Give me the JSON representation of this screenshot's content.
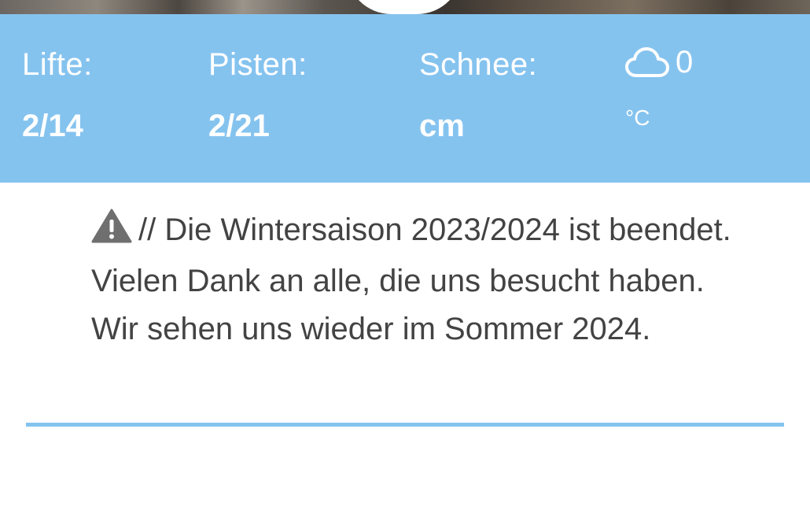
{
  "stats": {
    "lifts_label": "Lifte:",
    "lifts_value": "2/14",
    "slopes_label": "Pisten:",
    "slopes_value": "2/21",
    "snow_label": "Schnee:",
    "snow_value": "cm"
  },
  "weather": {
    "icon": "cloud-icon",
    "temperature": "0",
    "unit": "°C"
  },
  "notice": {
    "icon": "warning-icon",
    "text": "// Die Wintersaison 2023/2024 ist beendet. Vielen Dank an alle, die uns besucht haben. Wir sehen uns wieder im Sommer 2024."
  },
  "colors": {
    "accent": "#85c3ef",
    "text": "#434343",
    "icon": "#6f6f6f"
  }
}
